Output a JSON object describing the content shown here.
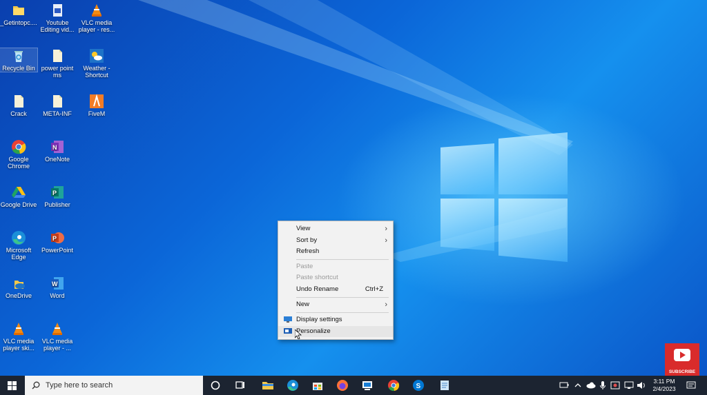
{
  "desktop_icons": [
    {
      "label": "_Getintopc....",
      "icon": "folder-icon"
    },
    {
      "label": "Youtube Editing vid...",
      "icon": "video-file-icon"
    },
    {
      "label": "VLC media player - res...",
      "icon": "vlc-icon"
    },
    {
      "label": "Recycle Bin",
      "icon": "recycle-bin-icon"
    },
    {
      "label": "power point ms",
      "icon": "file-icon"
    },
    {
      "label": "Weather - Shortcut",
      "icon": "weather-icon"
    },
    {
      "label": "Crack",
      "icon": "folder-icon"
    },
    {
      "label": "META-INF",
      "icon": "folder-icon"
    },
    {
      "label": "FiveM",
      "icon": "fivem-icon"
    },
    {
      "label": "Google Chrome",
      "icon": "chrome-icon"
    },
    {
      "label": "OneNote",
      "icon": "onenote-icon"
    },
    {
      "label": "Google Drive",
      "icon": "google-drive-icon"
    },
    {
      "label": "Publisher",
      "icon": "publisher-icon"
    },
    {
      "label": "Microsoft Edge",
      "icon": "edge-icon"
    },
    {
      "label": "PowerPoint",
      "icon": "powerpoint-icon"
    },
    {
      "label": "OneDrive",
      "icon": "onedrive-icon"
    },
    {
      "label": "Word",
      "icon": "word-icon"
    },
    {
      "label": "VLC media player ski...",
      "icon": "vlc-icon"
    },
    {
      "label": "VLC media player - ...",
      "icon": "vlc-icon"
    }
  ],
  "context_menu": {
    "view": "View",
    "sort_by": "Sort by",
    "refresh": "Refresh",
    "paste": "Paste",
    "paste_shortcut": "Paste shortcut",
    "undo_rename": "Undo Rename",
    "undo_shortcut": "Ctrl+Z",
    "new": "New",
    "display_settings": "Display settings",
    "personalize": "Personalize"
  },
  "taskbar": {
    "search_placeholder": "Type here to search",
    "apps": [
      "cortana-icon",
      "task-view-icon",
      "file-explorer-icon",
      "edge-icon",
      "store-icon",
      "firefox-icon",
      "snipping-tool-icon",
      "chrome-icon",
      "skype-icon",
      "notepad-icon"
    ],
    "time": "3:11 PM",
    "date": "2/4/2023"
  },
  "overlay": {
    "subscribe": "SUBSCRIBE"
  },
  "colors": {
    "accent": "#0a5fd6",
    "taskbar": "#1c2431",
    "subscribe": "#d92b2b"
  }
}
